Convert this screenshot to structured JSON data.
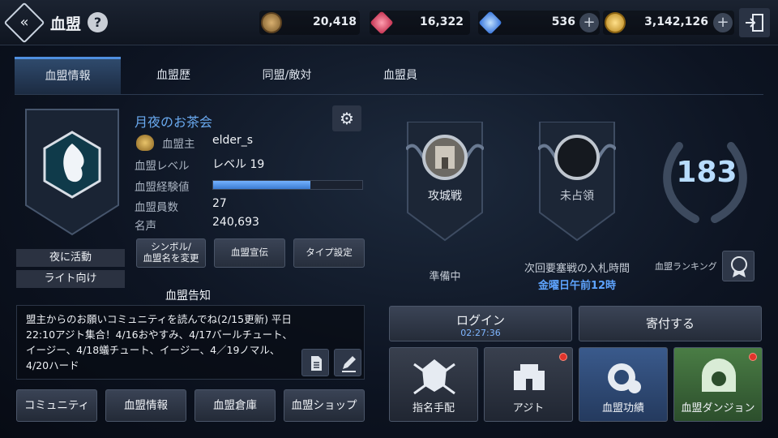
{
  "header": {
    "title": "血盟",
    "help_label": "?",
    "currencies": [
      {
        "name": "bronze-medal",
        "value": "20,418",
        "color": "#b48a4a"
      },
      {
        "name": "red-gem",
        "value": "16,322",
        "color": "#e0506a"
      },
      {
        "name": "blue-diamond",
        "value": "536",
        "color": "#4a8ff0"
      },
      {
        "name": "gold-coin",
        "value": "3,142,126",
        "color": "#e2b13c"
      }
    ],
    "plus": "+"
  },
  "tabs": [
    "血盟情報",
    "血盟歴",
    "同盟/敵対",
    "血盟員"
  ],
  "clan": {
    "name": "月夜のお茶会",
    "rows": [
      {
        "label": "血盟主",
        "value": "elder_s"
      },
      {
        "label": "血盟レベル",
        "value": "レベル 19"
      },
      {
        "label": "血盟経験値",
        "value": ""
      },
      {
        "label": "血盟員数",
        "value": "27"
      },
      {
        "label": "名声",
        "value": "240,693"
      }
    ],
    "xp_fraction": 0.65,
    "tags": [
      "夜に活動",
      "ライト向け"
    ],
    "actions": [
      "シンボル/\n血盟名を変更",
      "血盟宣伝",
      "タイプ設定"
    ]
  },
  "notice": {
    "title": "血盟告知",
    "text": "盟主からのお願いコミュニティを読んでね(2/15更新) 平日22:10アジト集合！4/16おやすみ、4/17バールチュート、イージー、4/18蟻チュート、イージー、4／19ノマル、4/20ハード"
  },
  "bottom_buttons": [
    "コミュニティ",
    "血盟情報",
    "血盟倉庫",
    "血盟ショップ"
  ],
  "siege": {
    "label": "攻城戦",
    "status": "準備中"
  },
  "fortress": {
    "label": "未占領",
    "status": "次回要塞戦の入札時間",
    "time": "金曜日午前12時"
  },
  "ranking": {
    "value": "183",
    "label": "血盟ランキング"
  },
  "login": {
    "label": "ログイン",
    "timer": "02:27:36"
  },
  "donate": {
    "label": "寄付する"
  },
  "tiles": [
    {
      "label": "指名手配",
      "dot": false
    },
    {
      "label": "アジト",
      "dot": true
    },
    {
      "label": "血盟功績",
      "dot": false
    },
    {
      "label": "血盟ダンジョン",
      "dot": true
    }
  ],
  "colors": {
    "accent": "#4f8fe0",
    "clan_name": "#6aaaf0",
    "green_tile": "#3f6b3a",
    "blue_tile": "#2e4a74"
  }
}
